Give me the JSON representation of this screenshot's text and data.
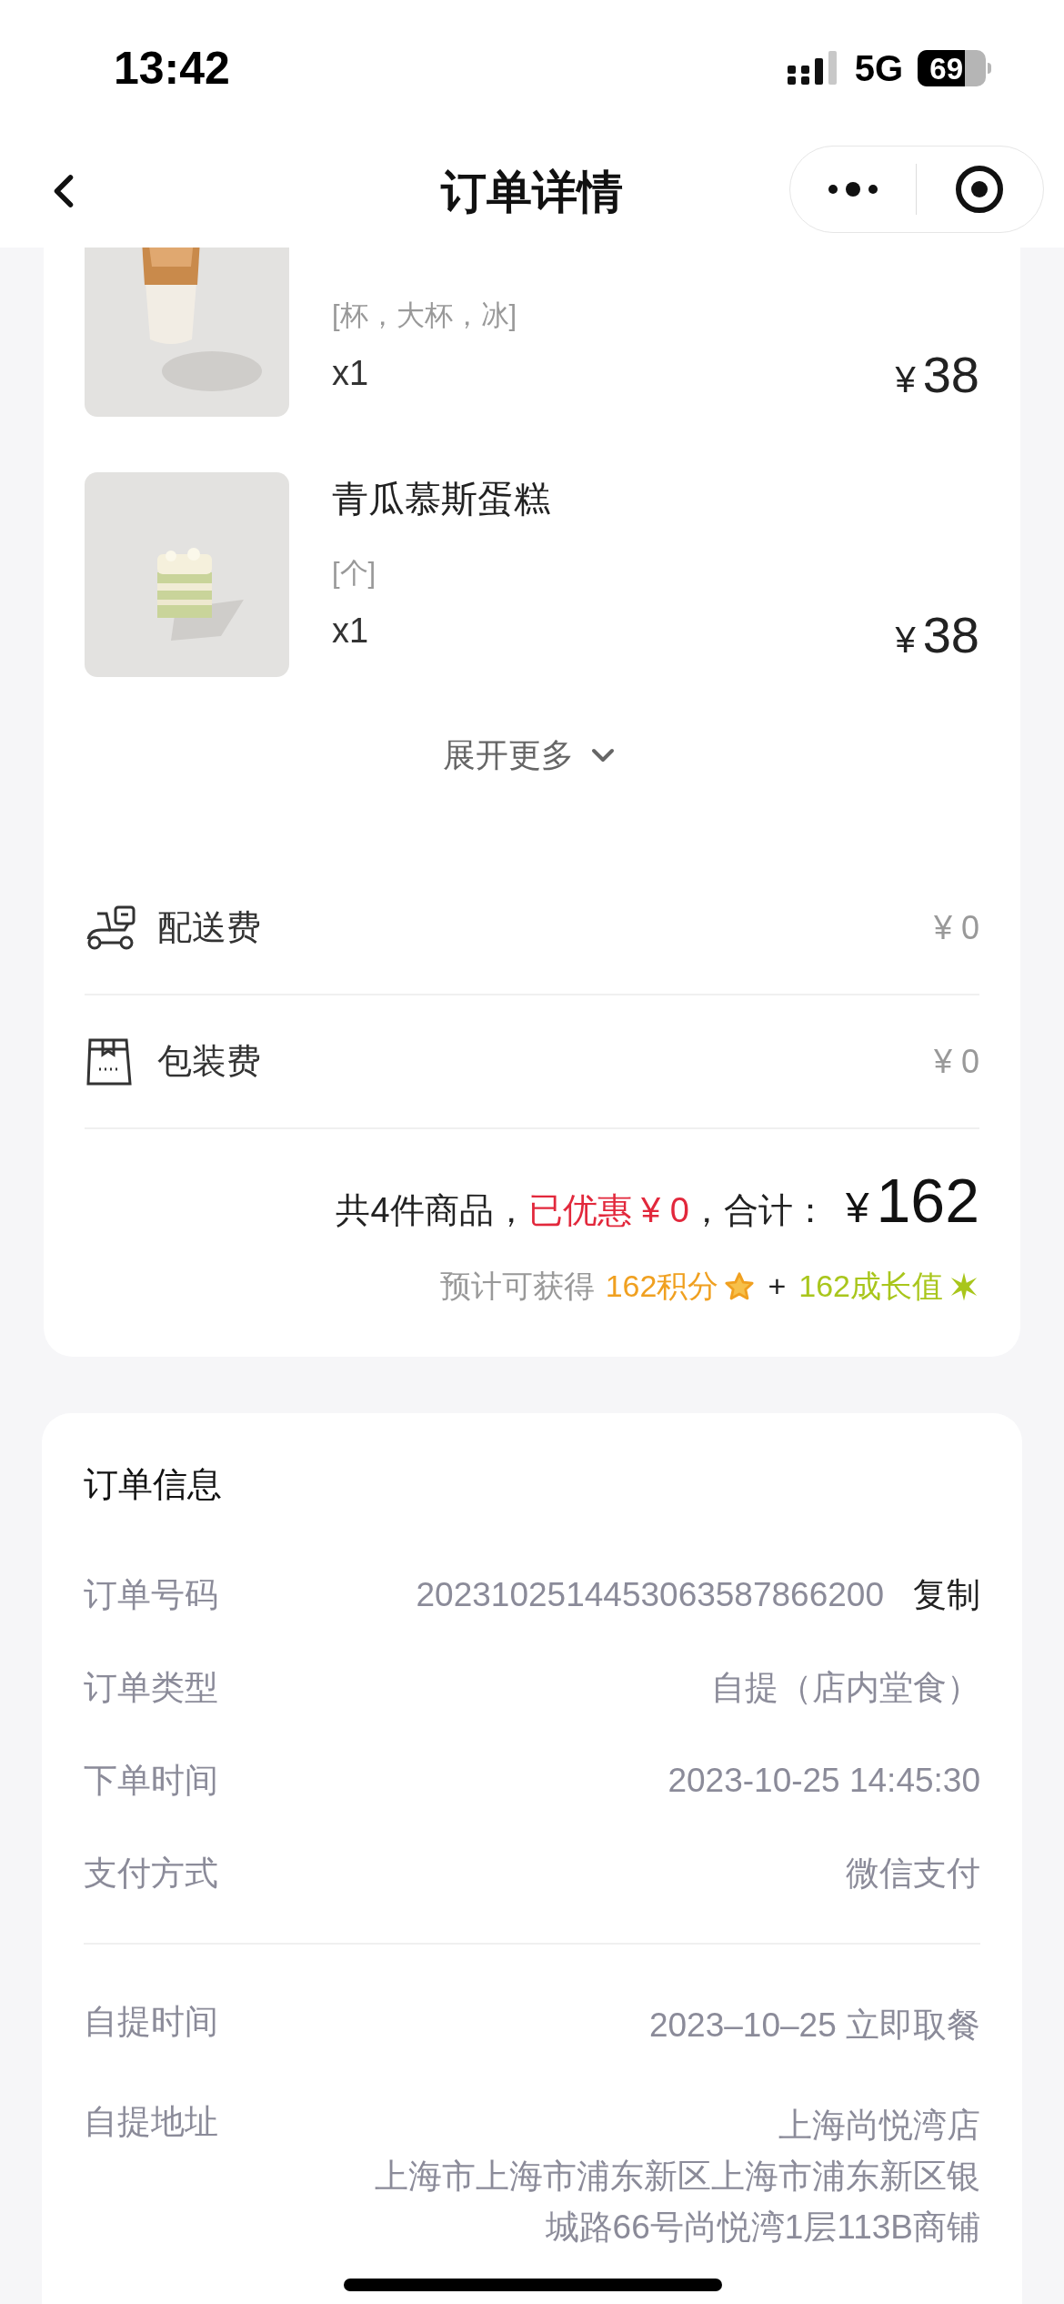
{
  "status_bar": {
    "time": "13:42",
    "network": "5G",
    "battery": "69"
  },
  "nav": {
    "title": "订单详情"
  },
  "products": [
    {
      "kind": "drink",
      "spec": "[杯，大杯，冰]",
      "quantity": "x1",
      "currency": "¥",
      "price": "38"
    },
    {
      "kind": "cake",
      "name": "青瓜慕斯蛋糕",
      "spec": "[个]",
      "quantity": "x1",
      "currency": "¥",
      "price": "38"
    }
  ],
  "expand": {
    "label": "展开更多"
  },
  "fees": [
    {
      "kind": "delivery",
      "label": "配送费",
      "amount": "¥ 0"
    },
    {
      "kind": "packaging",
      "label": "包装费",
      "amount": "¥ 0"
    }
  ],
  "summary": {
    "count_text": "共4件商品，",
    "discount": "已优惠 ¥ 0",
    "total_label": "，合计：",
    "currency": "¥",
    "total": "162"
  },
  "rewards": {
    "prefix": "预计可获得",
    "points": "162积分",
    "plus": "+",
    "growth": "162成长值"
  },
  "order_info": {
    "title": "订单信息",
    "rows": [
      {
        "label": "订单号码",
        "value": "2023102514453063587866200",
        "action": "复制"
      },
      {
        "label": "订单类型",
        "value": "自提（店内堂食）"
      },
      {
        "label": "下单时间",
        "value": "2023-10-25 14:45:30"
      },
      {
        "label": "支付方式",
        "value": "微信支付"
      }
    ],
    "pickup": [
      {
        "label": "自提时间",
        "lines": [
          "2023–10–25 立即取餐"
        ]
      },
      {
        "label": "自提地址",
        "lines": [
          "上海尚悦湾店",
          "上海市上海市浦东新区上海市浦东新区银",
          "城路66号尚悦湾1层113B商铺"
        ]
      }
    ]
  }
}
